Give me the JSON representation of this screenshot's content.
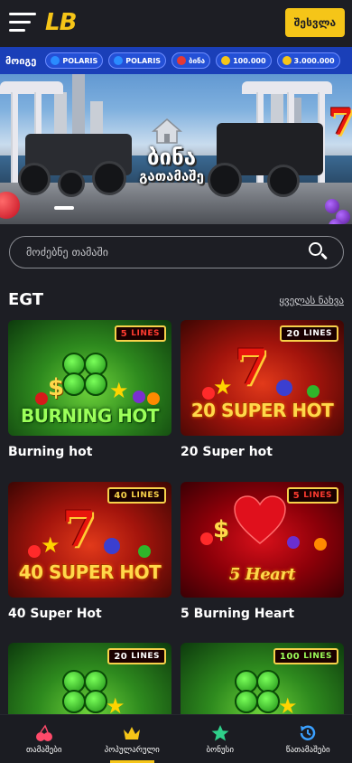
{
  "header": {
    "logo": "LB",
    "login_label": "შესვლა"
  },
  "banner": {
    "promo_label": "მოიგე",
    "promo_items": [
      {
        "text": "POLARIS",
        "color": "#2a8cff"
      },
      {
        "text": "POLARIS",
        "color": "#2a8cff"
      },
      {
        "text": "ბინა",
        "color": "#e53935"
      },
      {
        "text": "100.000",
        "color": "#f5c518"
      },
      {
        "text": "3.000.000",
        "color": "#f5c518"
      }
    ],
    "prize_line1": "ბინა",
    "prize_line2": "გათამაშე"
  },
  "search": {
    "placeholder": "მოძებნე თამაში"
  },
  "section": {
    "title": "EGT",
    "see_all": "ყველას ნახვა"
  },
  "games": [
    {
      "name": "Burning hot",
      "lines": "5",
      "lines_label": "LINES",
      "theme": "green",
      "art_text": "BURNING HOT"
    },
    {
      "name": "20 Super hot",
      "lines": "20",
      "lines_label": "LINES",
      "theme": "red",
      "art_text": "20 SUPER HOT"
    },
    {
      "name": "40 Super Hot",
      "lines": "40",
      "lines_label": "LINES",
      "theme": "red",
      "art_text": "40 SUPER HOT"
    },
    {
      "name": "5 Burning Heart",
      "lines": "5",
      "lines_label": "LINES",
      "theme": "darkred",
      "art_text": "5 Heart"
    },
    {
      "name": "",
      "lines": "20",
      "lines_label": "LINES",
      "theme": "green",
      "art_text": ""
    },
    {
      "name": "",
      "lines": "100",
      "lines_label": "LINES",
      "theme": "green",
      "art_text": ""
    }
  ],
  "bottom_nav": [
    {
      "label": "თამაშები",
      "icon": "cherries-icon",
      "active": false
    },
    {
      "label": "პოპულარული",
      "icon": "crown-icon",
      "active": true
    },
    {
      "label": "ბონუსი",
      "icon": "star-icon",
      "active": false
    },
    {
      "label": "წათამაშები",
      "icon": "history-icon",
      "active": false
    }
  ],
  "colors": {
    "accent": "#f5c518",
    "background": "#1d1e24",
    "promo_bar": "#1a3fb8"
  }
}
